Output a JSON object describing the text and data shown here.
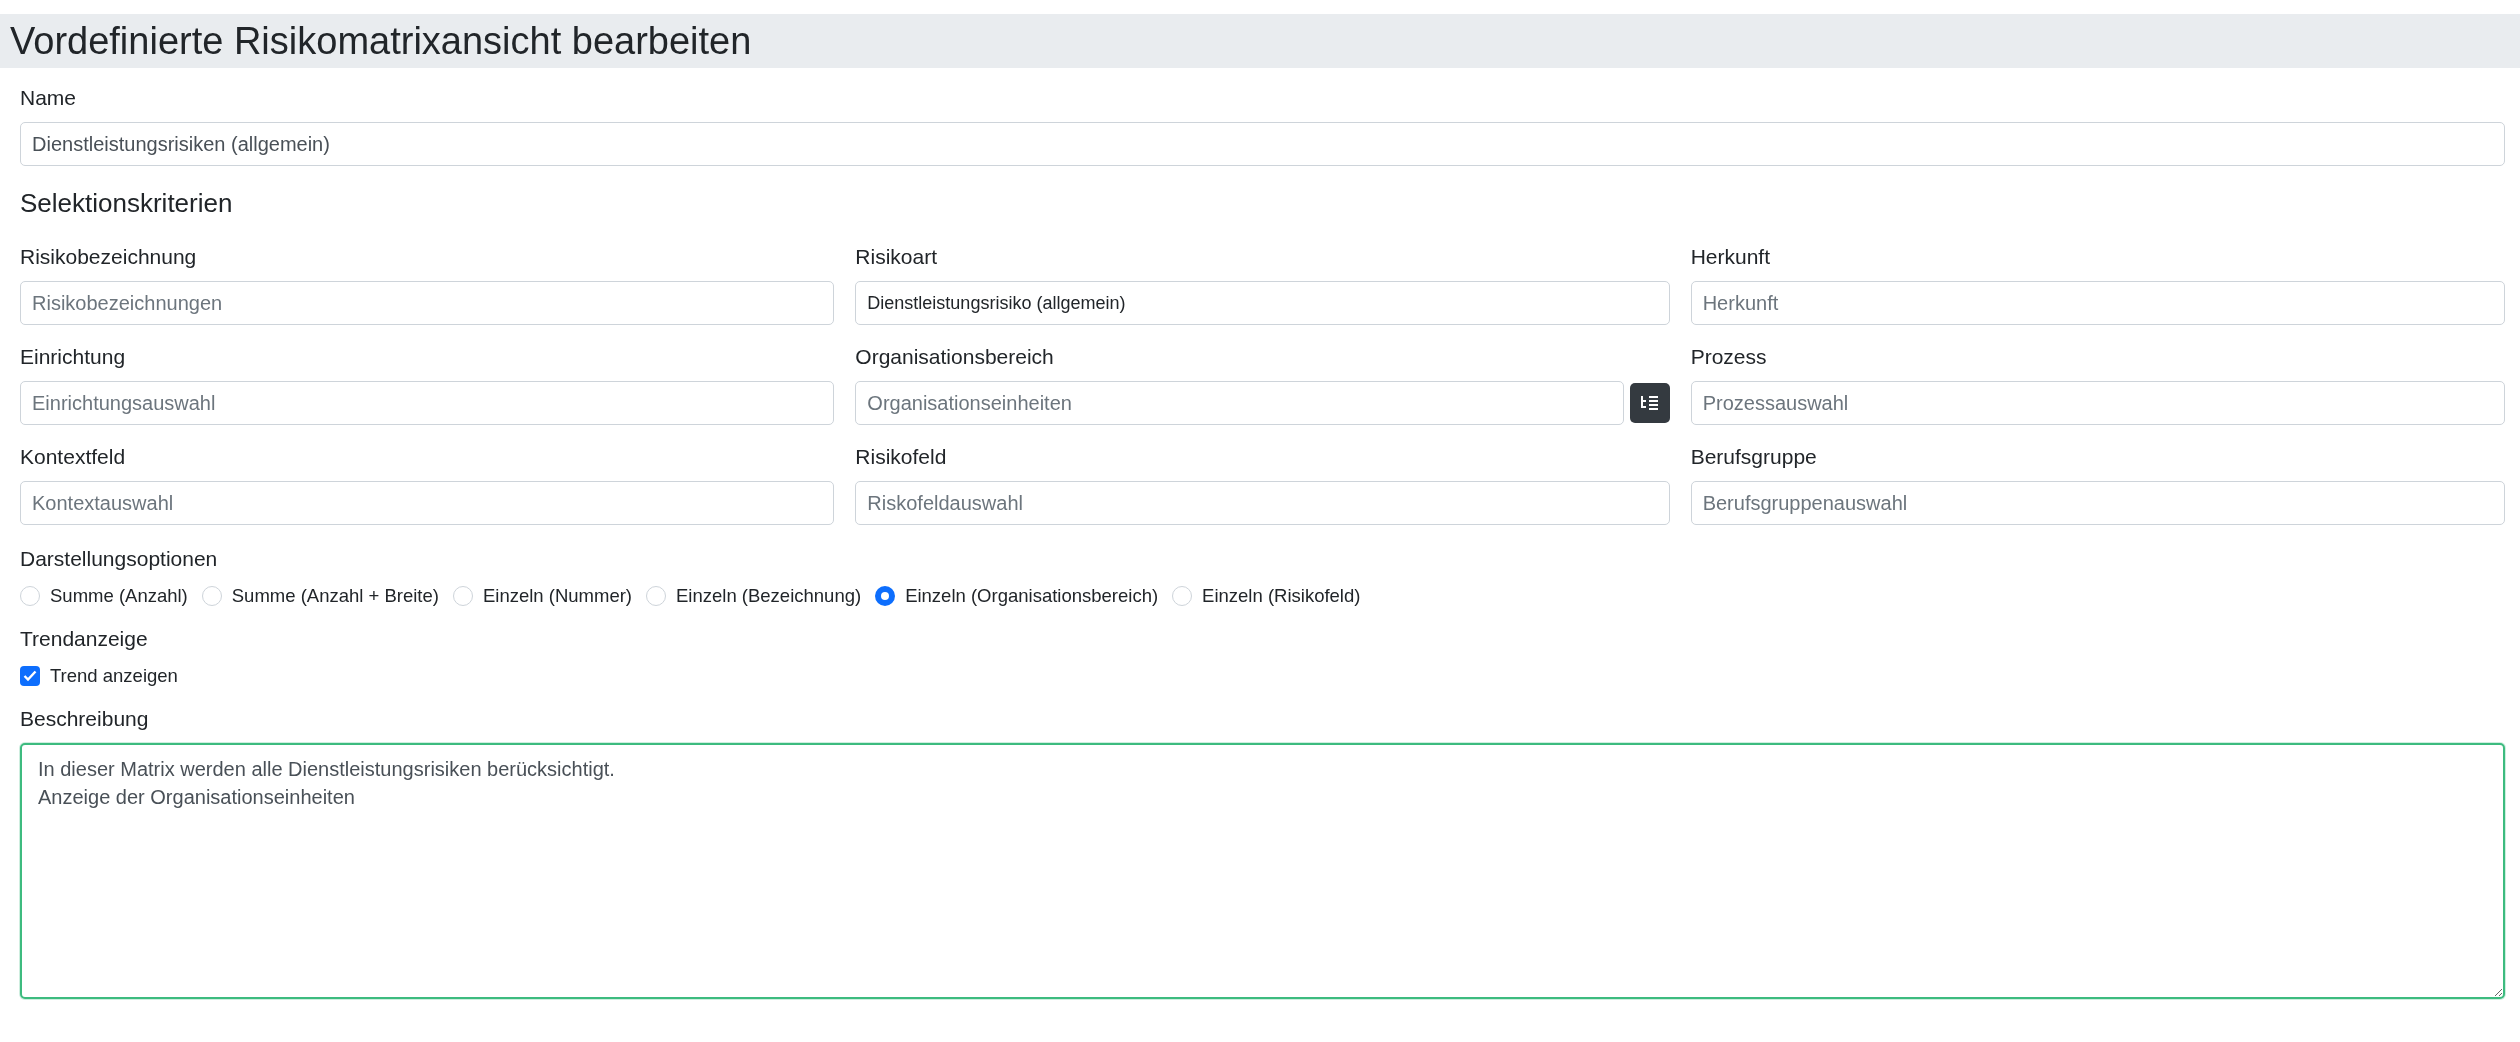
{
  "header": {
    "title": "Vordefinierte Risikomatrixansicht bearbeiten"
  },
  "name_field": {
    "label": "Name",
    "value": "Dienstleistungsrisiken (allgemein)"
  },
  "criteria": {
    "heading": "Selektionskriterien",
    "fields": [
      {
        "kind": "text",
        "label": "Risikobezeichnung",
        "placeholder": "Risikobezeichnungen"
      },
      {
        "kind": "text",
        "label": "Risikoart",
        "value": "Dienstleistungsrisiko (allgemein)"
      },
      {
        "kind": "text",
        "label": "Herkunft",
        "placeholder": "Herkunft"
      },
      {
        "kind": "text",
        "label": "Einrichtung",
        "placeholder": "Einrichtungsauswahl"
      },
      {
        "kind": "picker",
        "label": "Organisationsbereich",
        "placeholder": "Organisationseinheiten"
      },
      {
        "kind": "text",
        "label": "Prozess",
        "placeholder": "Prozessauswahl"
      },
      {
        "kind": "text",
        "label": "Kontextfeld",
        "placeholder": "Kontextauswahl"
      },
      {
        "kind": "text",
        "label": "Risikofeld",
        "placeholder": "Riskofeldauswahl"
      },
      {
        "kind": "text",
        "label": "Berufsgruppe",
        "placeholder": "Berufsgruppenauswahl"
      }
    ]
  },
  "display_options": {
    "label": "Darstellungsoptionen",
    "options": [
      {
        "label": "Summe (Anzahl)",
        "selected": false
      },
      {
        "label": "Summe (Anzahl + Breite)",
        "selected": false
      },
      {
        "label": "Einzeln (Nummer)",
        "selected": false
      },
      {
        "label": "Einzeln (Bezeichnung)",
        "selected": false
      },
      {
        "label": "Einzeln (Organisationsbereich)",
        "selected": true
      },
      {
        "label": "Einzeln (Risikofeld)",
        "selected": false
      }
    ]
  },
  "trend": {
    "label": "Trendanzeige",
    "checkbox": {
      "label": "Trend anzeigen",
      "checked": true
    }
  },
  "description": {
    "label": "Beschreibung",
    "value": "In dieser Matrix werden alle Dienstleistungsrisiken berücksichtigt.\nAnzeige der Organisationseinheiten",
    "focused": true
  }
}
